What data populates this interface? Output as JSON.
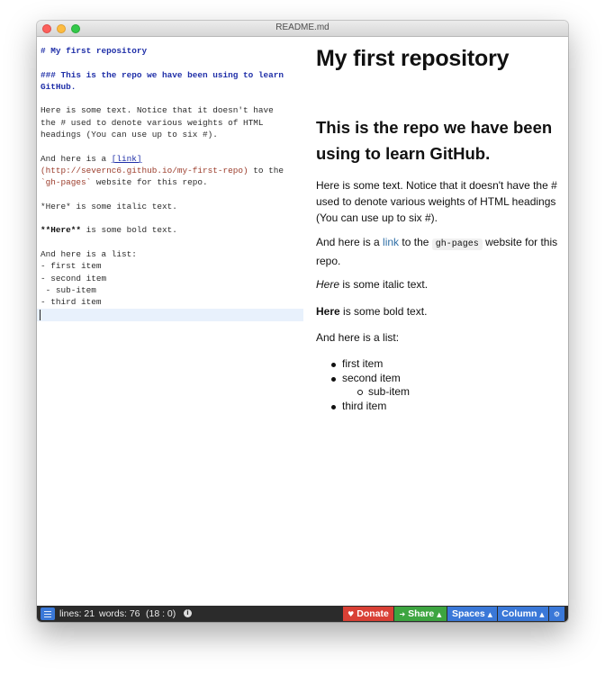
{
  "window": {
    "title": "README.md"
  },
  "editor": {
    "h1_line": "# My first repository",
    "h3_line_1": "### This is the repo we have been using to learn",
    "h3_line_2": "GitHub.",
    "p1_line_1": "Here is some text. Notice that it doesn't have",
    "p1_line_2": "the # used to denote various weights of HTML",
    "p1_line_3": "headings (You can use up to six #).",
    "p2_prefix": "And here is a ",
    "p2_link": "[link]",
    "p2_url": "(http://severnc6.github.io/my-first-repo)",
    "p2_url_suffix": " to the",
    "p2_code": "`gh-pages`",
    "p2_end": " website for this repo.",
    "italic_line": "*Here* is some italic text.",
    "bold_marker": "**Here**",
    "bold_rest": " is some bold text.",
    "list_intro": "And here is a list:",
    "list_lines": [
      "- first item",
      "- second item",
      " - sub-item",
      "- third item"
    ]
  },
  "preview": {
    "h1": "My first repository",
    "h3": "This is the repo we have been using to learn GitHub.",
    "p1": "Here is some text. Notice that it doesn't have the # used to denote various weights of HTML headings (You can use up to six #).",
    "p2_before": "And here is a ",
    "p2_link": "link",
    "p2_middle": " to the ",
    "p2_code": "gh-pages",
    "p2_after": " website for this repo.",
    "italic_word": "Here",
    "italic_rest": " is some italic text.",
    "bold_word": "Here",
    "bold_rest": " is some bold text.",
    "list_intro": "And here is a list:",
    "list_items": [
      "first item",
      "second item",
      "sub-item",
      "third item"
    ]
  },
  "statusbar": {
    "lines": "lines: 21",
    "words": "words: 76",
    "position": "(18 : 0)",
    "info_glyph": "i",
    "donate": "Donate",
    "share": "Share",
    "spaces": "Spaces",
    "column": "Column",
    "gear_glyph": "⚙",
    "dropdown_glyph": "▲",
    "donate_glyph": "♥",
    "share_glyph": "➜"
  }
}
